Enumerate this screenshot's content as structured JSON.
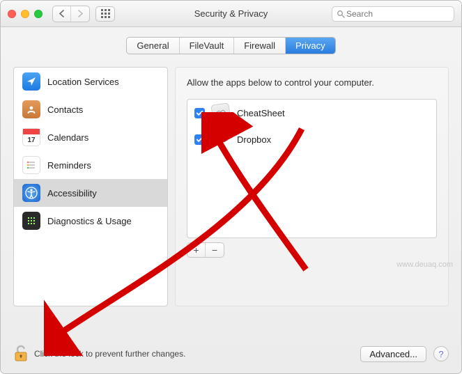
{
  "window": {
    "title": "Security & Privacy"
  },
  "search": {
    "placeholder": "Search"
  },
  "tabs": [
    "General",
    "FileVault",
    "Firewall",
    "Privacy"
  ],
  "tabs_selected_index": 3,
  "sidebar": {
    "items": [
      {
        "label": "Location Services"
      },
      {
        "label": "Contacts"
      },
      {
        "label": "Calendars"
      },
      {
        "label": "Reminders"
      },
      {
        "label": "Accessibility"
      },
      {
        "label": "Diagnostics & Usage"
      }
    ],
    "selected_index": 4,
    "calendar_day": "17"
  },
  "main": {
    "heading": "Allow the apps below to control your computer.",
    "apps": [
      {
        "name": "CheatSheet",
        "checked": true
      },
      {
        "name": "Dropbox",
        "checked": true
      }
    ]
  },
  "footer": {
    "lock_text": "Click the lock to prevent further changes.",
    "advanced_label": "Advanced...",
    "help_label": "?"
  },
  "watermark": "www.deuaq.com"
}
